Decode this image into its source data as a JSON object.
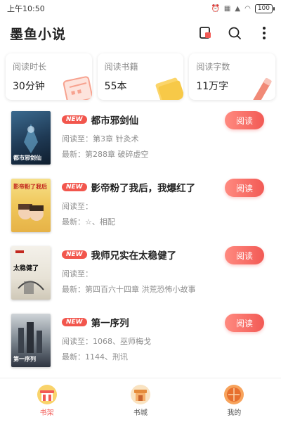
{
  "status": {
    "time": "上午10:50",
    "battery": "100"
  },
  "appbar": {
    "title": "墨鱼小说"
  },
  "stats": [
    {
      "label": "阅读时长",
      "value": "30分钟"
    },
    {
      "label": "阅读书籍",
      "value": "55本"
    },
    {
      "label": "阅读字数",
      "value": "11万字"
    }
  ],
  "books": [
    {
      "badge": "NEW",
      "title": "都市邪剑仙",
      "line1": "阅读至：第3章 针灸术",
      "line2": "最新：第288章 破碎虚空",
      "button": "阅读",
      "cover_text": "都市邪剑仙"
    },
    {
      "badge": "NEW",
      "title": "影帝粉了我后，我爆红了",
      "line1": "阅读至：",
      "line2": "最新：☆、相配",
      "button": "阅读",
      "cover_text": "影帝粉了我后"
    },
    {
      "badge": "NEW",
      "title": "我师兄实在太稳健了",
      "line1": "阅读至：",
      "line2": "最新：第四百六十四章 洪荒恐怖小故事",
      "button": "阅读",
      "cover_text": "太稳健了"
    },
    {
      "badge": "NEW",
      "title": "第一序列",
      "line1": "阅读至：1068、巫师梅戈",
      "line2": "最新：1144、刑讯",
      "button": "阅读",
      "cover_text": "第一序列"
    }
  ],
  "tabs": [
    {
      "label": "书架",
      "icon": "bookshelf-icon",
      "active": true
    },
    {
      "label": "书城",
      "icon": "bookstore-icon",
      "active": false
    },
    {
      "label": "我的",
      "icon": "profile-icon",
      "active": false
    }
  ],
  "colors": {
    "accent": "#f25a55",
    "badge": "#f2564d"
  }
}
